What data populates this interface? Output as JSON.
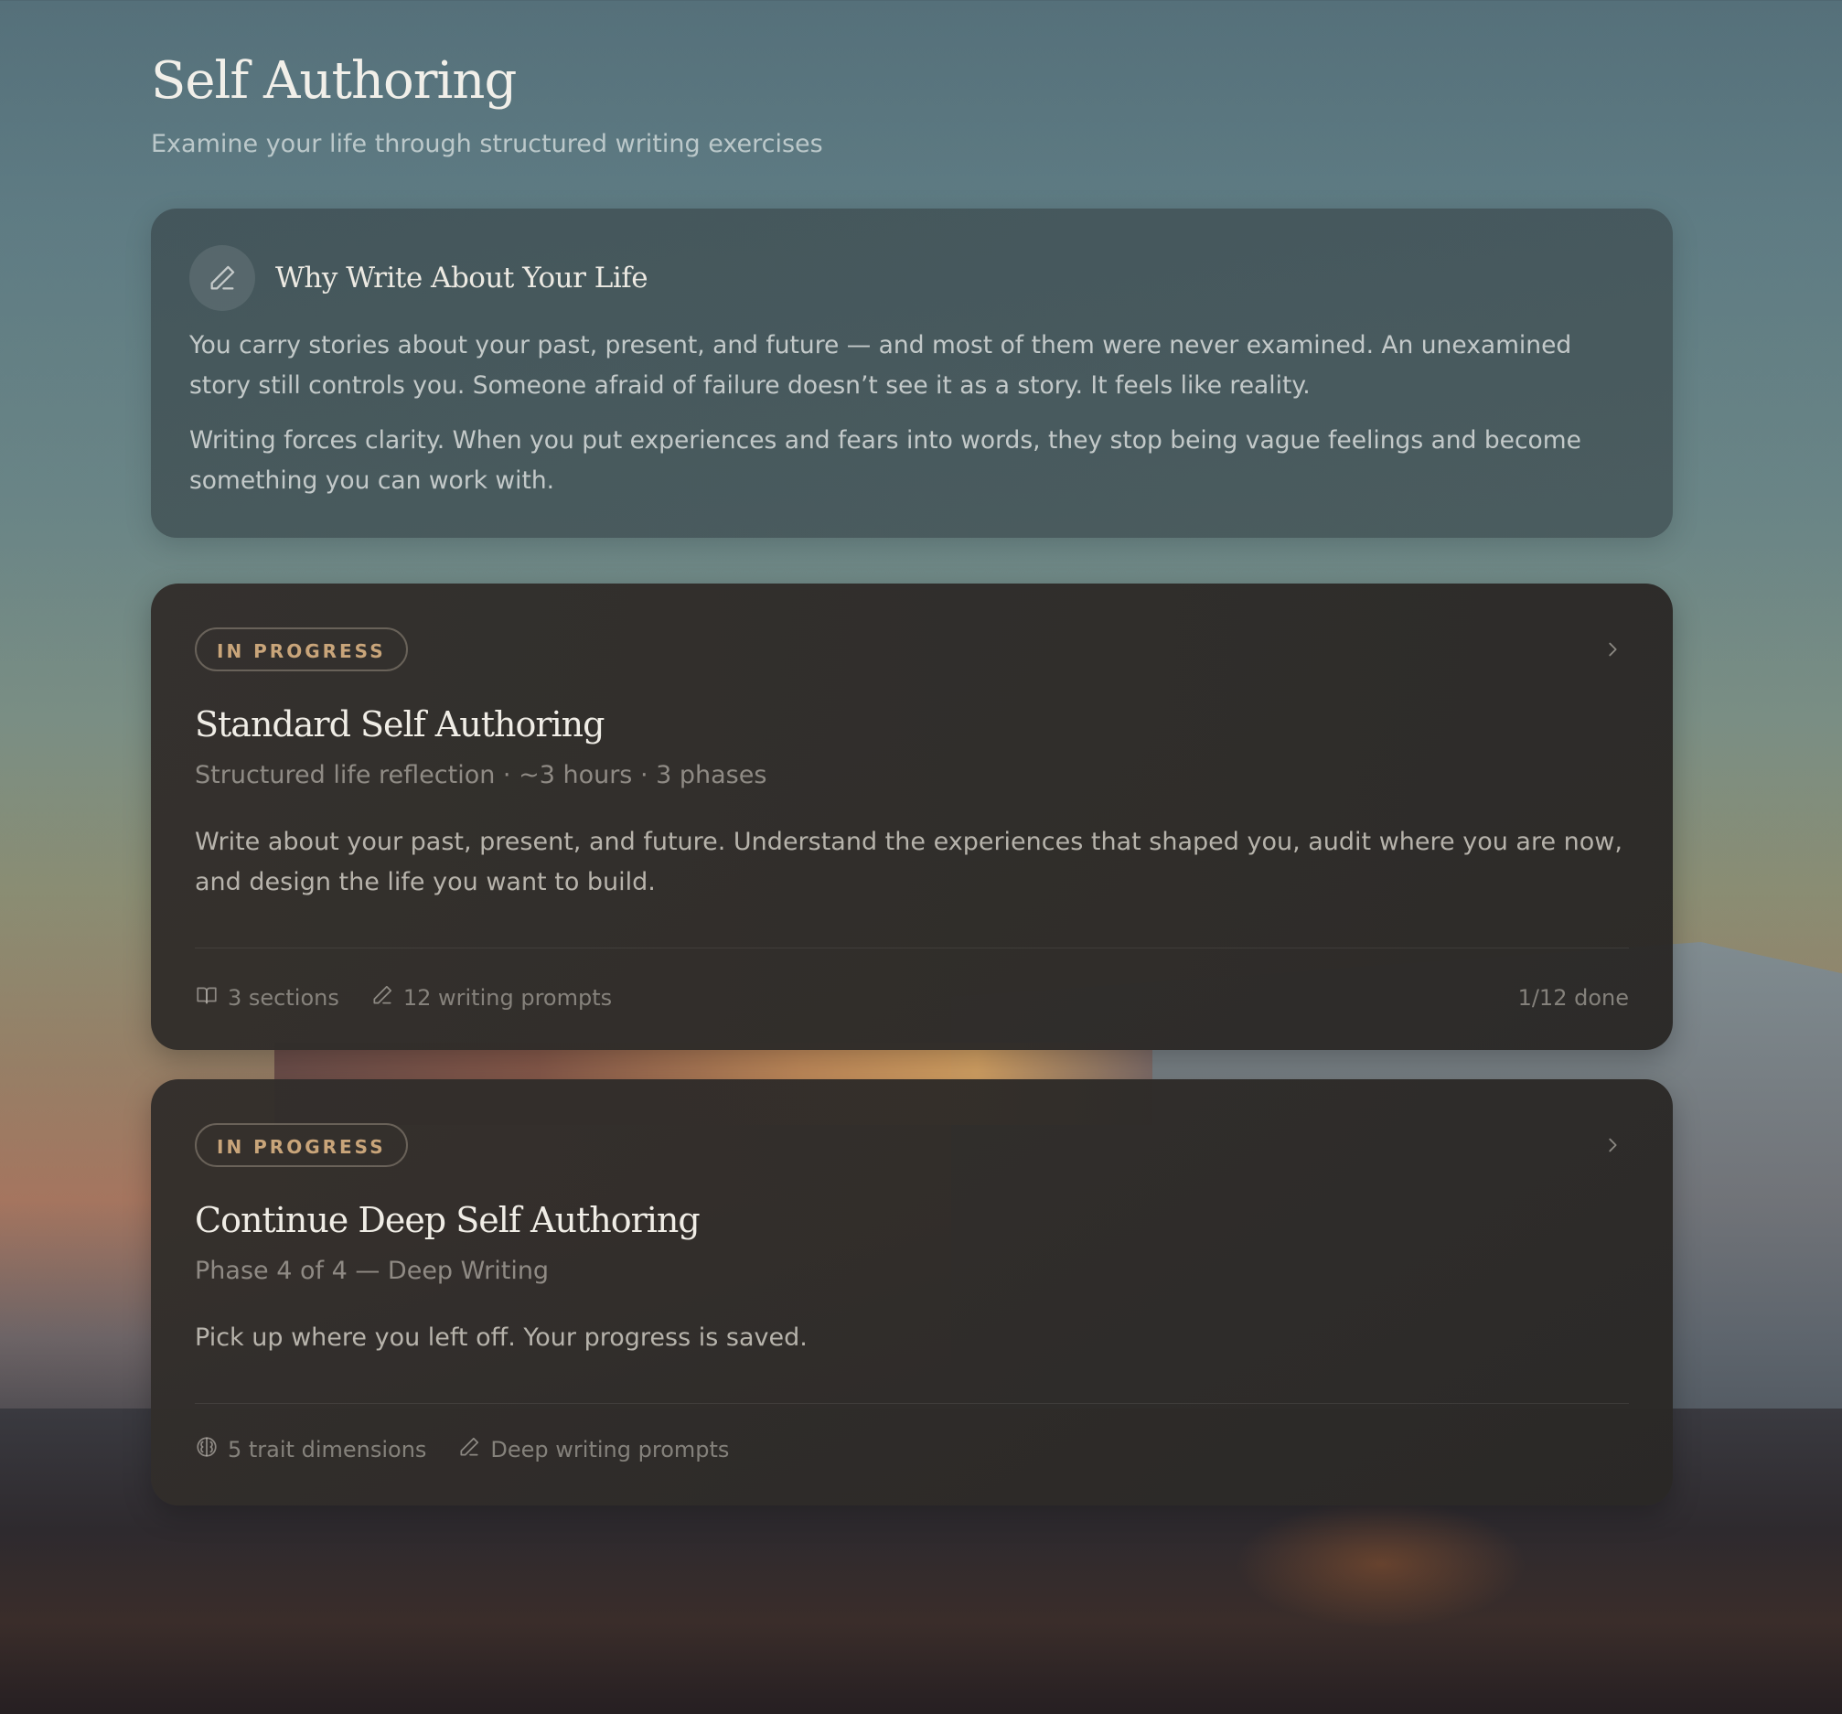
{
  "header": {
    "title": "Self Authoring",
    "subtitle": "Examine your life through structured writing exercises"
  },
  "intro": {
    "icon": "pencil-icon",
    "title": "Why Write About Your Life",
    "paragraphs": [
      "You carry stories about your past, present, and future — and most of them were never examined. An unexamined story still controls you. Someone afraid of failure doesn’t see it as a story. It feels like reality.",
      "Writing forces clarity. When you put experiences and fears into words, they stop being vague feelings and become something you can work with."
    ]
  },
  "courses": [
    {
      "status": "IN PROGRESS",
      "title": "Standard Self Authoring",
      "meta": "Structured life reflection · ~3 hours · 3 phases",
      "description": "Write about your past, present, and future. Understand the experiences that shaped you, audit where you are now, and design the life you want to build.",
      "footer": [
        {
          "icon": "book-open-icon",
          "label": "3 sections"
        },
        {
          "icon": "pencil-icon",
          "label": "12 writing prompts"
        }
      ],
      "progress": "1/12 done"
    },
    {
      "status": "IN PROGRESS",
      "title": "Continue Deep Self Authoring",
      "meta": "Phase 4 of 4 — Deep Writing",
      "description": "Pick up where you left off. Your progress is saved.",
      "footer": [
        {
          "icon": "brain-icon",
          "label": "5 trait dimensions"
        },
        {
          "icon": "pencil-icon",
          "label": "Deep writing prompts"
        }
      ]
    }
  ],
  "colors": {
    "badge_text": "#c9a57a",
    "card_bg": "#2f2c2a",
    "intro_bg": "#3f4c50"
  }
}
